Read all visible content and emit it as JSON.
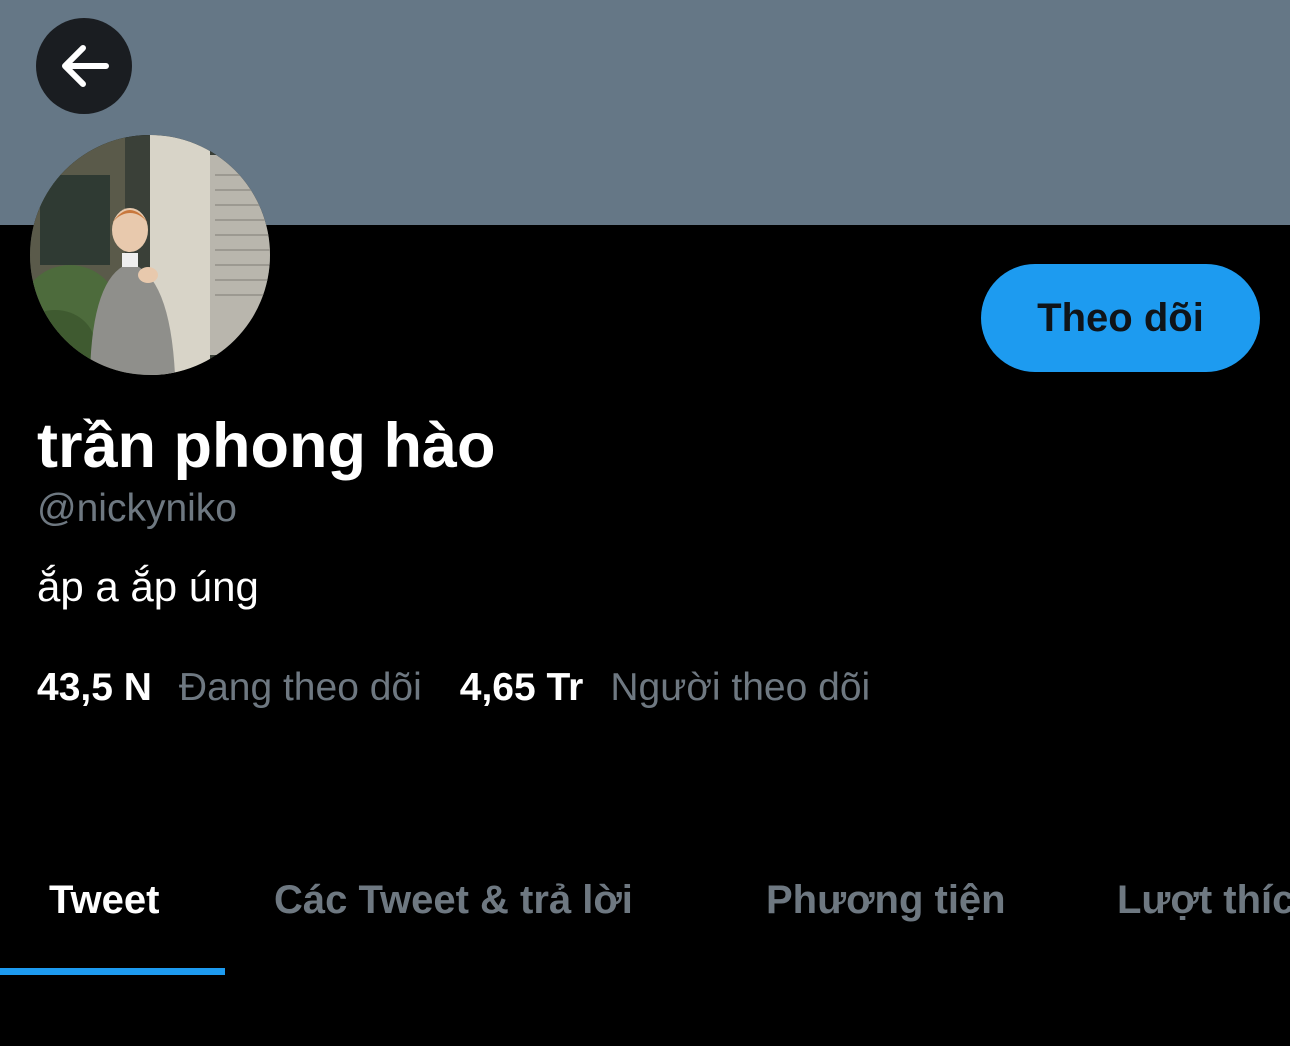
{
  "header": {
    "banner_color": "#657786",
    "back_icon": "arrow-left-icon"
  },
  "profile": {
    "display_name": "trần phong hào",
    "handle": "@nickyniko",
    "bio": "ắp a ắp úng",
    "follow_label": "Theo dõi",
    "avatar": "profile-photo"
  },
  "stats": {
    "following_count": "43,5 N",
    "following_label": "Đang theo dõi",
    "followers_count": "4,65 Tr",
    "followers_label": "Người theo dõi"
  },
  "tabs": [
    {
      "label": "Tweet",
      "active": true
    },
    {
      "label": "Các Tweet & trả lời",
      "active": false
    },
    {
      "label": "Phương tiện",
      "active": false
    },
    {
      "label": "Lượt thích",
      "active": false
    }
  ],
  "colors": {
    "accent": "#1d9bf0",
    "background": "#000000",
    "secondary_text": "#6e7881",
    "primary_text": "#ffffff"
  }
}
